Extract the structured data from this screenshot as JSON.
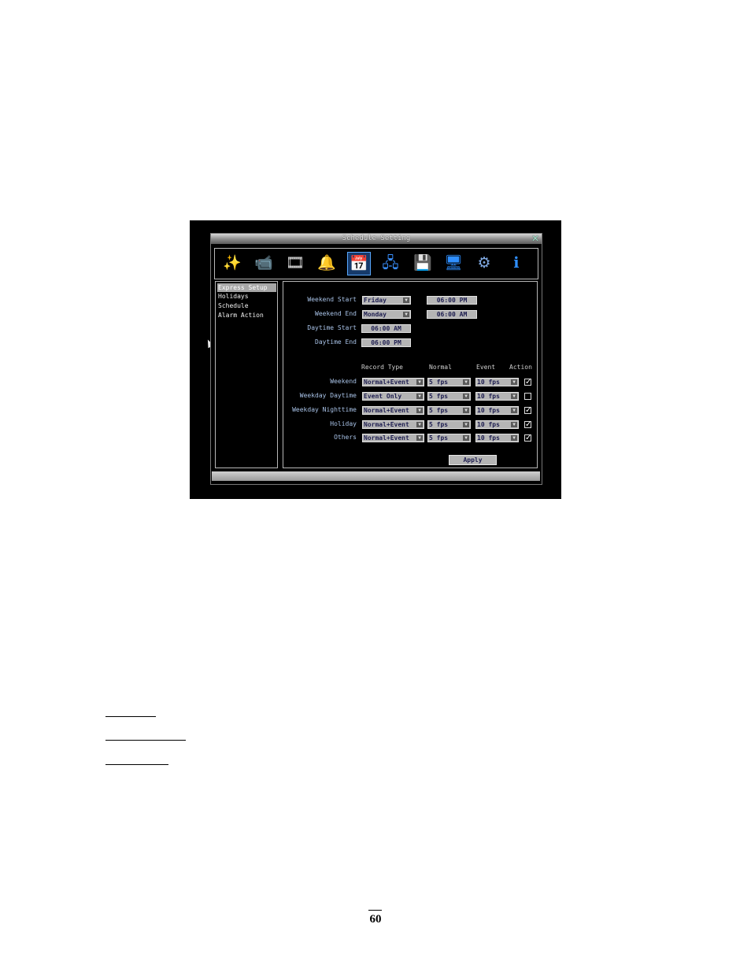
{
  "window": {
    "title": "Schedule Setting",
    "close_glyph": "✕"
  },
  "toolbar": {
    "icons": [
      {
        "name": "wizard-wand-icon",
        "glyph": "✨",
        "color": "#f0d060"
      },
      {
        "name": "camera-icon",
        "glyph": "📹",
        "color": "#cccccc"
      },
      {
        "name": "film-reel-icon",
        "glyph": "🎞",
        "color": "#dddddd"
      },
      {
        "name": "bell-icon",
        "glyph": "🔔",
        "color": "#f0b020"
      },
      {
        "name": "schedule-calendar-icon",
        "glyph": "📅",
        "color": "#60d060"
      },
      {
        "name": "network-icon",
        "glyph": "🖧",
        "color": "#3a90ff"
      },
      {
        "name": "disk-icon",
        "glyph": "💾",
        "color": "#e0a030"
      },
      {
        "name": "monitor-icon",
        "glyph": "🖥",
        "color": "#2f8fff"
      },
      {
        "name": "settings-gears-icon",
        "glyph": "⚙",
        "color": "#7fa8e0"
      },
      {
        "name": "info-icon",
        "glyph": "ℹ",
        "color": "#2f8fff"
      }
    ]
  },
  "menu": {
    "items": [
      "Express Setup",
      "Holidays",
      "Schedule",
      "Alarm Action"
    ],
    "selected_index": 0
  },
  "express": {
    "weekend_start_label": "Weekend Start",
    "weekend_start_day": "Friday",
    "weekend_start_time": "06:00 PM",
    "weekend_end_label": "Weekend End",
    "weekend_end_day": "Monday",
    "weekend_end_time": "06:00 AM",
    "daytime_start_label": "Daytime Start",
    "daytime_start_time": "06:00 AM",
    "daytime_end_label": "Daytime End",
    "daytime_end_time": "06:00 PM"
  },
  "table": {
    "headers": {
      "record_type": "Record Type",
      "normal": "Normal",
      "event": "Event",
      "action": "Action"
    },
    "rows": [
      {
        "label": "Weekend",
        "record_type": "Normal+Event",
        "normal": "5 fps",
        "event": "10 fps",
        "action": true
      },
      {
        "label": "Weekday Daytime",
        "record_type": "Event Only",
        "normal": "5 fps",
        "event": "10 fps",
        "action": false
      },
      {
        "label": "Weekday Nighttime",
        "record_type": "Normal+Event",
        "normal": "5 fps",
        "event": "10 fps",
        "action": true
      },
      {
        "label": "Holiday",
        "record_type": "Normal+Event",
        "normal": "5 fps",
        "event": "10 fps",
        "action": true
      },
      {
        "label": "Others",
        "record_type": "Normal+Event",
        "normal": "5 fps",
        "event": "10 fps",
        "action": true
      }
    ]
  },
  "apply_label": "Apply",
  "dropdown_arrow": "▼",
  "check_glyph": "✓",
  "page_number": "60"
}
